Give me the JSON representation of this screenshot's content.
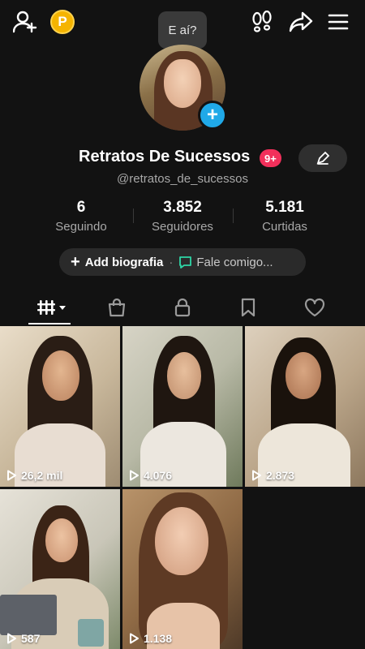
{
  "bubble_text": "E aí?",
  "coin_letter": "P",
  "profile": {
    "name": "Retratos De Sucessos",
    "notification_count": "9+",
    "handle": "@retratos_de_sucessos"
  },
  "stats": [
    {
      "value": "6",
      "label": "Seguindo"
    },
    {
      "value": "3.852",
      "label": "Seguidores"
    },
    {
      "value": "5.181",
      "label": "Curtidas"
    }
  ],
  "bio": {
    "plus": "+",
    "add_label": "Add biografia",
    "separator": "·",
    "contact_label": "Fale comigo..."
  },
  "tabs": [
    "videos-grid",
    "shop",
    "private",
    "saved",
    "liked"
  ],
  "videos": [
    {
      "views": "26,2 mil"
    },
    {
      "views": "4.076"
    },
    {
      "views": "2.873"
    },
    {
      "views": "587"
    },
    {
      "views": "1.138"
    }
  ],
  "colors": {
    "background": "#121212",
    "accent_blue": "#20a9e8",
    "badge_red": "#f2305b",
    "coin_gold": "#f5b400"
  }
}
